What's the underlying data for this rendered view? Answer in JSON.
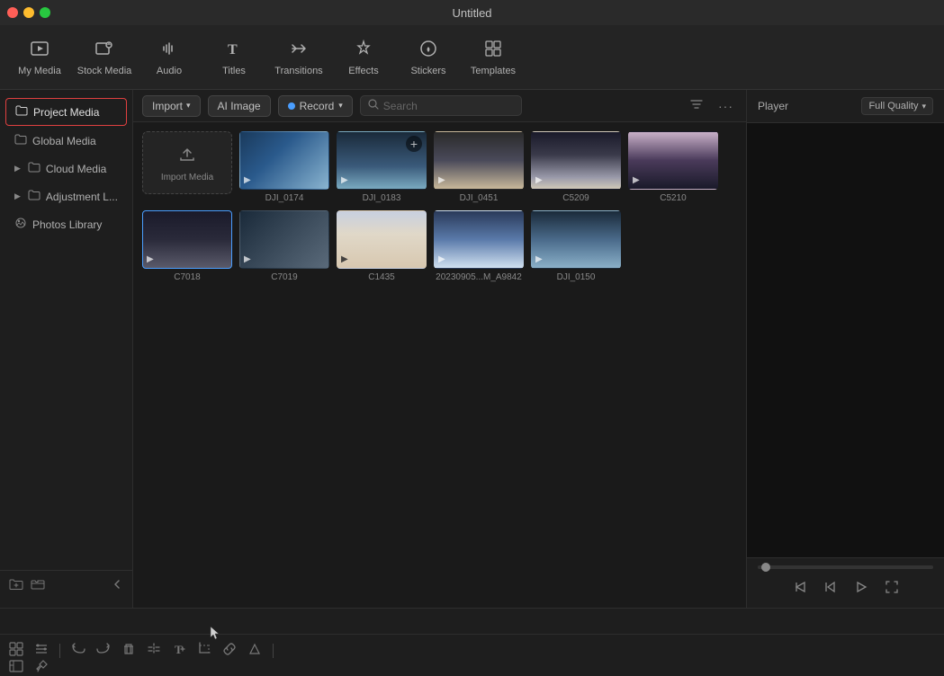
{
  "titlebar": {
    "title": "Untitled"
  },
  "toolbar": {
    "items": [
      {
        "id": "my-media",
        "label": "My Media",
        "icon": "🎞"
      },
      {
        "id": "stock-media",
        "label": "Stock Media",
        "icon": "📹"
      },
      {
        "id": "audio",
        "label": "Audio",
        "icon": "🎵"
      },
      {
        "id": "titles",
        "label": "Titles",
        "icon": "T"
      },
      {
        "id": "transitions",
        "label": "Transitions",
        "icon": "↔"
      },
      {
        "id": "effects",
        "label": "Effects",
        "icon": "✦"
      },
      {
        "id": "stickers",
        "label": "Stickers",
        "icon": "🌟"
      },
      {
        "id": "templates",
        "label": "Templates",
        "icon": "⊞"
      }
    ]
  },
  "sidebar": {
    "items": [
      {
        "id": "project-media",
        "label": "Project Media",
        "active": true
      },
      {
        "id": "global-media",
        "label": "Global Media",
        "active": false
      },
      {
        "id": "cloud-media",
        "label": "Cloud Media",
        "active": false
      },
      {
        "id": "adjustment",
        "label": "Adjustment L...",
        "active": false
      },
      {
        "id": "photos-library",
        "label": "Photos Library",
        "active": false
      }
    ]
  },
  "content_toolbar": {
    "import_label": "Import",
    "ai_image_label": "AI Image",
    "record_label": "Record",
    "search_placeholder": "Search"
  },
  "media_items": [
    {
      "id": "import-media",
      "type": "import",
      "label": "Import Media"
    },
    {
      "id": "dji0174",
      "label": "DJI_0174",
      "thumb": "dji0174"
    },
    {
      "id": "dji0183",
      "label": "DJI_0183",
      "thumb": "dji0183"
    },
    {
      "id": "dji0451",
      "label": "DJI_0451",
      "thumb": "dji0451"
    },
    {
      "id": "c5209",
      "label": "C5209",
      "thumb": "c5209"
    },
    {
      "id": "c5210",
      "label": "C5210",
      "thumb": "c5210"
    },
    {
      "id": "c7018",
      "label": "C7018",
      "thumb": "c7018",
      "selected": true
    },
    {
      "id": "c7019",
      "label": "C7019",
      "thumb": "c7019"
    },
    {
      "id": "c1435",
      "label": "C1435",
      "thumb": "c1435"
    },
    {
      "id": "20230905",
      "label": "20230905...M_A9842",
      "thumb": "20230905"
    },
    {
      "id": "dji0150",
      "label": "DJI_0150",
      "thumb": "dji0150"
    }
  ],
  "player": {
    "label": "Player",
    "quality_label": "Full Quality"
  },
  "bottom_toolbar": {
    "icons": [
      "select",
      "trim",
      "divider",
      "undo",
      "redo",
      "delete",
      "split",
      "text",
      "crop",
      "link",
      "shape"
    ]
  }
}
